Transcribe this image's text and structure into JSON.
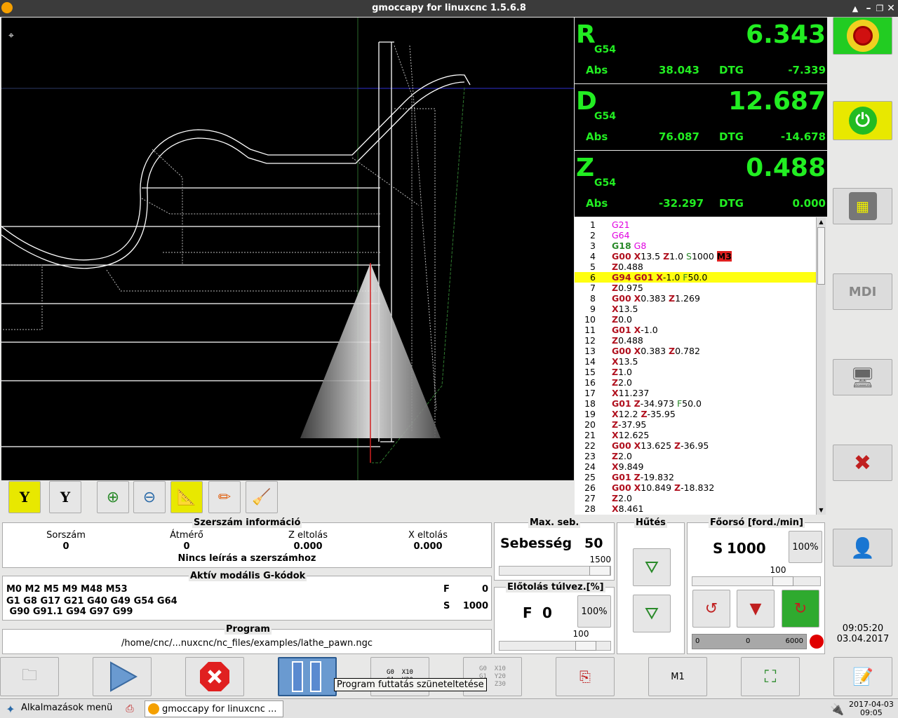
{
  "window": {
    "title": "gmoccapy for linuxcnc  1.5.6.8"
  },
  "dro": [
    {
      "axis": "R",
      "sys": "G54",
      "value": "6.343",
      "abs_label": "Abs",
      "abs": "38.043",
      "dtg_label": "DTG",
      "dtg": "-7.339"
    },
    {
      "axis": "D",
      "sys": "G54",
      "value": "12.687",
      "abs_label": "Abs",
      "abs": "76.087",
      "dtg_label": "DTG",
      "dtg": "-14.678"
    },
    {
      "axis": "Z",
      "sys": "G54",
      "value": "0.488",
      "abs_label": "Abs",
      "abs": "-32.297",
      "dtg_label": "DTG",
      "dtg": "0.000"
    }
  ],
  "gcode": [
    {
      "n": "1",
      "html": "<span class='m'>G21</span>"
    },
    {
      "n": "2",
      "html": "<span class='m'>G64</span>"
    },
    {
      "n": "3",
      "html": "<span class='g'>G18</span> <span class='m'>G8</span>"
    },
    {
      "n": "4",
      "html": "<span class='r'>G00</span> <span class='r'>X</span>13.5 <span class='r'>Z</span>1.0 <span class='blk'>S</span>1000 <span class='m3'>M3</span>"
    },
    {
      "n": "5",
      "html": "<span class='r'>Z</span>0.488"
    },
    {
      "n": "6",
      "html": "<span class='r'>G94</span> <span class='r'>G01</span> <span class='r'>X</span>-1.0 <span class='blk'>F</span>50.0",
      "active": true
    },
    {
      "n": "7",
      "html": "<span class='r'>Z</span>0.975"
    },
    {
      "n": "8",
      "html": "<span class='r'>G00</span> <span class='r'>X</span>0.383 <span class='r'>Z</span>1.269"
    },
    {
      "n": "9",
      "html": "<span class='r'>X</span>13.5"
    },
    {
      "n": "10",
      "html": "<span class='r'>Z</span>0.0"
    },
    {
      "n": "11",
      "html": "<span class='r'>G01</span> <span class='r'>X</span>-1.0"
    },
    {
      "n": "12",
      "html": "<span class='r'>Z</span>0.488"
    },
    {
      "n": "13",
      "html": "<span class='r'>G00</span> <span class='r'>X</span>0.383 <span class='r'>Z</span>0.782"
    },
    {
      "n": "14",
      "html": "<span class='r'>X</span>13.5"
    },
    {
      "n": "15",
      "html": "<span class='r'>Z</span>1.0"
    },
    {
      "n": "16",
      "html": "<span class='r'>Z</span>2.0"
    },
    {
      "n": "17",
      "html": "<span class='r'>X</span>11.237"
    },
    {
      "n": "18",
      "html": "<span class='r'>G01</span> <span class='r'>Z</span>-34.973 <span class='blk'>F</span>50.0"
    },
    {
      "n": "19",
      "html": "<span class='r'>X</span>12.2 <span class='r'>Z</span>-35.95"
    },
    {
      "n": "20",
      "html": "<span class='r'>Z</span>-37.95"
    },
    {
      "n": "21",
      "html": "<span class='r'>X</span>12.625"
    },
    {
      "n": "22",
      "html": "<span class='r'>G00</span> <span class='r'>X</span>13.625 <span class='r'>Z</span>-36.95"
    },
    {
      "n": "23",
      "html": "<span class='r'>Z</span>2.0"
    },
    {
      "n": "24",
      "html": "<span class='r'>X</span>9.849"
    },
    {
      "n": "25",
      "html": "<span class='r'>G01</span> <span class='r'>Z</span>-19.832"
    },
    {
      "n": "26",
      "html": "<span class='r'>G00</span> <span class='r'>X</span>10.849 <span class='r'>Z</span>-18.832"
    },
    {
      "n": "27",
      "html": "<span class='r'>Z</span>2.0"
    },
    {
      "n": "28",
      "html": "<span class='r'>X</span>8.461"
    }
  ],
  "tool": {
    "title": "Szerszám információ",
    "col_num": "Sorszám",
    "col_dia": "Átmérő",
    "col_zoff": "Z eltolás",
    "col_xoff": "X eltolás",
    "num": "0",
    "dia": "0",
    "zoff": "0.000",
    "xoff": "0.000",
    "desc": "Nincs leírás a szerszámhoz"
  },
  "gcodes": {
    "title": "Aktív modális G-kódok",
    "line1": "M0 M2 M5 M9 M48 M53",
    "line2": "G1 G8 G17 G21 G40 G49 G54 G64",
    "line3": " G90 G91.1 G94 G97 G99",
    "f_label": "F",
    "f_value": "0",
    "s_label": "S",
    "s_value": "1000"
  },
  "program": {
    "title": "Program",
    "path": "/home/cnc/...nuxcnc/nc_files/examples/lathe_pawn.ngc"
  },
  "maxvel": {
    "title": "Max. seb.",
    "label": "Sebesség",
    "value": "50",
    "max": "1500"
  },
  "feed": {
    "title": "Előtolás túlvez.[%]",
    "label": "F",
    "value": "0",
    "btn": "100%",
    "slider": "100"
  },
  "cool": {
    "title": "Hűtés"
  },
  "spindle": {
    "title": "Főorsó [ford./min]",
    "label": "S",
    "value": "1000",
    "btn": "100%",
    "slider": "100",
    "bar_min": "0",
    "bar_val": "0",
    "bar_max": "6000"
  },
  "clock": {
    "time": "09:05:20",
    "date": "03.04.2017"
  },
  "mdi_label": "MDI",
  "bottom": {
    "m1": "M1",
    "tooltip": "Program futtatás szüneteltetése",
    "gcode_a": "G0  X10\nG1  Y20",
    "gcode_b": "G0  X10\nG1  Y20\nG1  Z30"
  },
  "taskbar": {
    "menu": "Alkalmazások menü",
    "app": "gmoccapy for linuxcnc ...",
    "date": "2017-04-03",
    "time": "09:05"
  }
}
